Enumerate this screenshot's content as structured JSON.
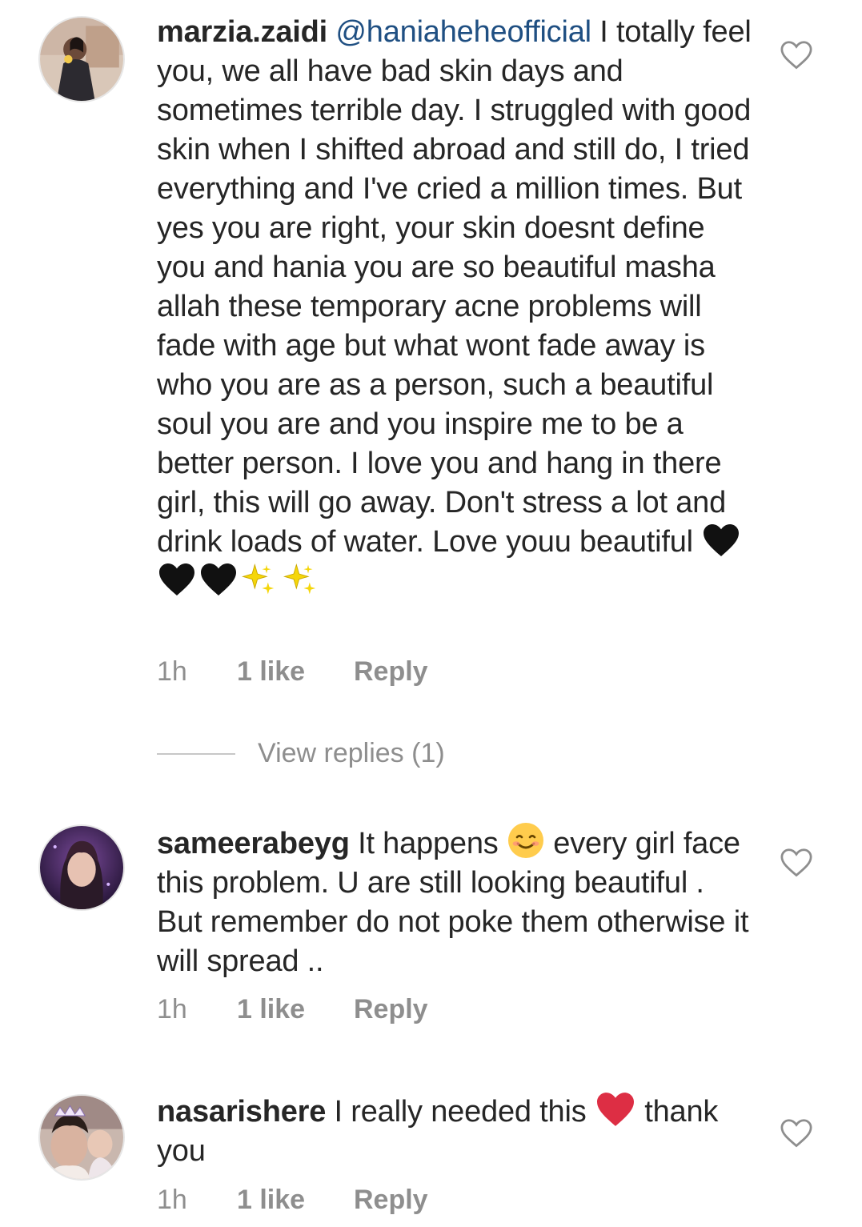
{
  "comments": [
    {
      "username": "marzia.zaidi",
      "mention": "@haniaheheofficial",
      "text": " I totally feel you, we all have bad skin days and sometimes terrible day. I struggled with good skin when I shifted abroad and still do, I tried everything and I've cried a million times. But yes you are right, your skin doesnt define you and hania you are so beautiful masha allah these temporary acne problems will fade with age but what wont fade away is who you are as a person, such a beautiful soul you are and you inspire me to be a better person. I love you and hang in there girl, this will go away. Don't stress a lot and drink loads of water. Love youu beautiful ",
      "emojis": [
        "black-heart",
        "black-heart",
        "black-heart",
        "sparkles",
        "sparkles"
      ],
      "time": "1h",
      "likes": "1 like",
      "reply": "Reply",
      "view_replies": "View replies (1)"
    },
    {
      "username": "sameerabeyg",
      "text_before": " It happens ",
      "emoji": "smiling-face",
      "text_after": " every girl face this problem. U are still looking beautiful . But remember do not poke them otherwise it will spread ..",
      "time": "1h",
      "likes": "1 like",
      "reply": "Reply"
    },
    {
      "username": "nasarishere",
      "text_before": " I really needed this ",
      "emoji": "red-heart",
      "text_after": " thank you",
      "time": "1h",
      "likes": "1 like",
      "reply": "Reply"
    }
  ],
  "colors": {
    "text": "#262626",
    "mention": "#1f4f82",
    "meta": "#8e8e8e",
    "divider": "#c7c7c7"
  }
}
